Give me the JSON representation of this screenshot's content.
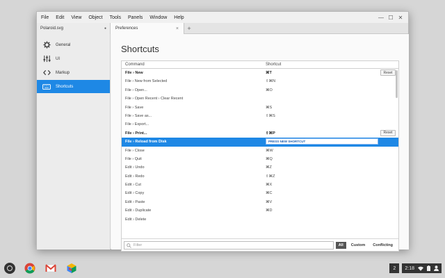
{
  "menu": [
    "File",
    "Edit",
    "View",
    "Object",
    "Tools",
    "Panels",
    "Window",
    "Help"
  ],
  "window_controls": {
    "minimize": "—",
    "maximize": "☐",
    "close": "✕"
  },
  "doc_tab": {
    "label": "Polaroid.svg",
    "marker": "●"
  },
  "prefs_tab": {
    "label": "Preferences",
    "close": "×"
  },
  "new_tab": "+",
  "sidebar": {
    "items": [
      {
        "label": "General",
        "icon": "gear-icon"
      },
      {
        "label": "UI",
        "icon": "sliders-icon"
      },
      {
        "label": "Markup",
        "icon": "code-icon"
      },
      {
        "label": "Shortcuts",
        "icon": "keyboard-icon",
        "active": true
      }
    ]
  },
  "page": {
    "title": "Shortcuts"
  },
  "table": {
    "headers": {
      "command": "Command",
      "shortcut": "Shortcut"
    },
    "rows": [
      {
        "command": "File › New",
        "shortcut": "⌘T",
        "bold": true,
        "reset": "Reset"
      },
      {
        "command": "File › New from Selected",
        "shortcut": "⇧⌘N"
      },
      {
        "command": "File › Open...",
        "shortcut": "⌘O"
      },
      {
        "command": "File › Open Recent › Clear Recent",
        "shortcut": ""
      },
      {
        "command": "File › Save",
        "shortcut": "⌘S"
      },
      {
        "command": "File › Save as...",
        "shortcut": "⇧⌘S"
      },
      {
        "command": "File › Export...",
        "shortcut": ""
      },
      {
        "command": "File › Print...",
        "shortcut": "⇧⌘P",
        "bold": true,
        "reset": "Reset"
      },
      {
        "command": "File › Reload from Disk",
        "shortcut": "PRESS NEW SHORTCUT",
        "selected": true,
        "bold": true
      },
      {
        "command": "File › Close",
        "shortcut": "⌘W"
      },
      {
        "command": "File › Quit",
        "shortcut": "⌘Q"
      },
      {
        "command": "Edit › Undo",
        "shortcut": "⌘Z"
      },
      {
        "command": "Edit › Redo",
        "shortcut": "⇧⌘Z"
      },
      {
        "command": "Edit › Cut",
        "shortcut": "⌘X"
      },
      {
        "command": "Edit › Copy",
        "shortcut": "⌘C"
      },
      {
        "command": "Edit › Paste",
        "shortcut": "⌘V"
      },
      {
        "command": "Edit › Duplicate",
        "shortcut": "⌘D"
      },
      {
        "command": "Edit › Delete",
        "shortcut": ""
      }
    ]
  },
  "footer": {
    "filter_placeholder": "Filter",
    "filter_value": "",
    "buttons": [
      "All",
      "Custom",
      "Conflicting"
    ],
    "active_button": "All"
  },
  "shelf": {
    "notifications": "2",
    "time": "2:18"
  },
  "colors": {
    "accent": "#1e88e5"
  }
}
